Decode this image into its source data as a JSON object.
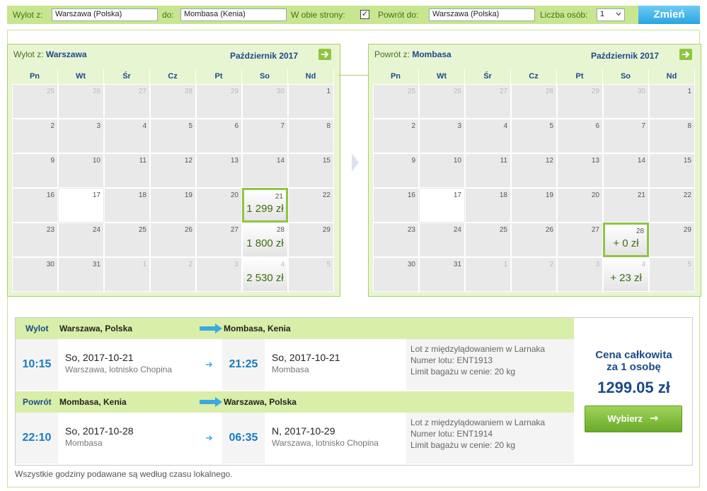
{
  "search": {
    "from_label": "Wylot z:",
    "from_value": "Warszawa (Polska)",
    "to_label": "do:",
    "to_value": "Mombasa (Kenia)",
    "both_ways_label": "W obie strony:",
    "both_ways_checked": "✓",
    "return_label": "Powrót do:",
    "return_value": "Warszawa (Polska)",
    "persons_label": "Liczba osób:",
    "persons_value": "1",
    "change_button": "Zmień"
  },
  "calendars": {
    "days_of_week": [
      "Pn",
      "Wt",
      "Śr",
      "Cz",
      "Pt",
      "So",
      "Nd"
    ],
    "outbound": {
      "title_prefix": "Wylot z:",
      "title_city": "Warszawa",
      "month": "Październik 2017",
      "weeks": [
        [
          {
            "d": "25",
            "m": 1
          },
          {
            "d": "26",
            "m": 1
          },
          {
            "d": "27",
            "m": 1
          },
          {
            "d": "28",
            "m": 1
          },
          {
            "d": "29",
            "m": 1
          },
          {
            "d": "30",
            "m": 1
          },
          {
            "d": "1"
          }
        ],
        [
          {
            "d": "2"
          },
          {
            "d": "3"
          },
          {
            "d": "4"
          },
          {
            "d": "5"
          },
          {
            "d": "6"
          },
          {
            "d": "7"
          },
          {
            "d": "8"
          }
        ],
        [
          {
            "d": "9"
          },
          {
            "d": "10"
          },
          {
            "d": "11"
          },
          {
            "d": "12"
          },
          {
            "d": "13"
          },
          {
            "d": "14"
          },
          {
            "d": "15"
          }
        ],
        [
          {
            "d": "16"
          },
          {
            "d": "17",
            "e": 1
          },
          {
            "d": "18"
          },
          {
            "d": "19"
          },
          {
            "d": "20"
          },
          {
            "d": "21",
            "p": "1 299 zł",
            "s": 1
          },
          {
            "d": "22"
          }
        ],
        [
          {
            "d": "23"
          },
          {
            "d": "24"
          },
          {
            "d": "25"
          },
          {
            "d": "26"
          },
          {
            "d": "27"
          },
          {
            "d": "28",
            "p": "1 800 zł"
          },
          {
            "d": "29"
          }
        ],
        [
          {
            "d": "30"
          },
          {
            "d": "31"
          },
          {
            "d": "1",
            "m": 1
          },
          {
            "d": "2",
            "m": 1
          },
          {
            "d": "3",
            "m": 1
          },
          {
            "d": "4",
            "m": 1,
            "p": "2 530 zł"
          },
          {
            "d": "5",
            "m": 1
          }
        ]
      ]
    },
    "return": {
      "title_prefix": "Powrót z:",
      "title_city": "Mombasa",
      "month": "Październik 2017",
      "weeks": [
        [
          {
            "d": "25",
            "m": 1
          },
          {
            "d": "26",
            "m": 1
          },
          {
            "d": "27",
            "m": 1
          },
          {
            "d": "28",
            "m": 1
          },
          {
            "d": "29",
            "m": 1
          },
          {
            "d": "30",
            "m": 1
          },
          {
            "d": "1"
          }
        ],
        [
          {
            "d": "2"
          },
          {
            "d": "3"
          },
          {
            "d": "4"
          },
          {
            "d": "5"
          },
          {
            "d": "6"
          },
          {
            "d": "7"
          },
          {
            "d": "8"
          }
        ],
        [
          {
            "d": "9"
          },
          {
            "d": "10"
          },
          {
            "d": "11"
          },
          {
            "d": "12"
          },
          {
            "d": "13"
          },
          {
            "d": "14"
          },
          {
            "d": "15"
          }
        ],
        [
          {
            "d": "16"
          },
          {
            "d": "17",
            "e": 1
          },
          {
            "d": "18"
          },
          {
            "d": "19"
          },
          {
            "d": "20"
          },
          {
            "d": "21"
          },
          {
            "d": "22"
          }
        ],
        [
          {
            "d": "23"
          },
          {
            "d": "24"
          },
          {
            "d": "25"
          },
          {
            "d": "26"
          },
          {
            "d": "27"
          },
          {
            "d": "28",
            "p": "+ 0 zł",
            "s": 1
          },
          {
            "d": "29"
          }
        ],
        [
          {
            "d": "30"
          },
          {
            "d": "31"
          },
          {
            "d": "1",
            "m": 1
          },
          {
            "d": "2",
            "m": 1
          },
          {
            "d": "3",
            "m": 1
          },
          {
            "d": "4",
            "m": 1,
            "p": "+ 23 zł"
          },
          {
            "d": "5",
            "m": 1
          }
        ]
      ]
    }
  },
  "summary": {
    "outbound": {
      "label": "Wylot",
      "from": "Warszawa, Polska",
      "to": "Mombasa, Kenia",
      "dep_time": "10:15",
      "dep_date": "So, 2017-10-21",
      "dep_place": "Warszawa, lotnisko Chopina",
      "arr_time": "21:25",
      "arr_date": "So, 2017-10-21",
      "arr_place": "Mombasa",
      "info1": "Lot z międzylądowaniem w Larnaka",
      "info2": "Numer lotu: ENT1913",
      "info3": "Limit bagażu w cenie: 20 kg"
    },
    "return": {
      "label": "Powrót",
      "from": "Mombasa, Kenia",
      "to": "Warszawa, Polska",
      "dep_time": "22:10",
      "dep_date": "So, 2017-10-28",
      "dep_place": "Mombasa",
      "arr_time": "06:35",
      "arr_date": "N, 2017-10-29",
      "arr_place": "Warszawa, lotnisko Chopina",
      "info1": "Lot z międzylądowaniem w Larnaka",
      "info2": "Numer lotu: ENT1914",
      "info3": "Limit bagażu w cenie: 20 kg"
    },
    "price_label_line1": "Cena całkowita",
    "price_label_line2": "za 1 osobę",
    "price_value": "1299.05 zł",
    "choose_button": "Wybierz"
  },
  "footnote": "Wszystkie godziny podawane są według czasu lokalnego.",
  "colors": {
    "accent_green": "#8ec641",
    "header_blue": "#1a4a8a",
    "time_blue": "#1a7bc0",
    "button_blue": "#29a5e0"
  }
}
